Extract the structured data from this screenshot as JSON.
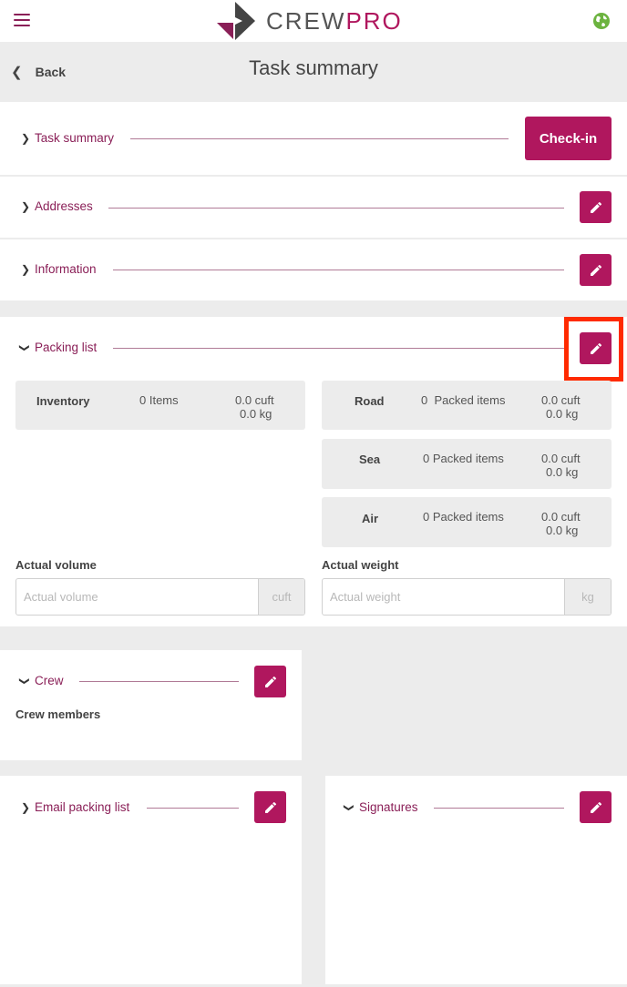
{
  "app": {
    "brand_left": "CREW",
    "brand_right": "PRO",
    "menu_icon": "hamburger-menu-icon",
    "language_icon": "globe-icon",
    "accent_color": "#b0175e"
  },
  "nav": {
    "back_label": "Back",
    "page_title": "Task summary"
  },
  "sections": {
    "task_summary": {
      "title": "Task summary",
      "button": "Check-in"
    },
    "addresses": {
      "title": "Addresses"
    },
    "information": {
      "title": "Information"
    },
    "packing_list": {
      "title": "Packing list",
      "inventory": {
        "label": "Inventory",
        "items": "0 Items",
        "volume": "0.0 cuft",
        "weight": "0.0 kg"
      },
      "transport": [
        {
          "label": "Road",
          "packed": "0  Packed items",
          "volume": "0.0 cuft",
          "weight": "0.0 kg"
        },
        {
          "label": "Sea",
          "packed": "0 Packed items",
          "volume": "0.0 cuft",
          "weight": "0.0 kg"
        },
        {
          "label": "Air",
          "packed": "0 Packed items",
          "volume": "0.0 cuft",
          "weight": "0.0 kg"
        }
      ],
      "actual_volume": {
        "label": "Actual volume",
        "placeholder": "Actual volume",
        "unit": "cuft"
      },
      "actual_weight": {
        "label": "Actual weight",
        "placeholder": "Actual weight",
        "unit": "kg"
      }
    },
    "crew": {
      "title": "Crew",
      "members_label": "Crew members"
    },
    "email_packing_list": {
      "title": "Email packing list"
    },
    "signatures": {
      "title": "Signatures"
    }
  }
}
